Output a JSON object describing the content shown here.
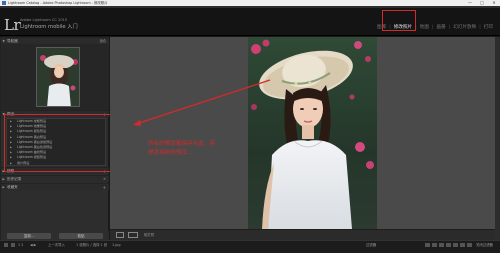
{
  "window": {
    "title": "Lightroom Catalog - Adobe Photoshop Lightroom - 修改照片",
    "controls": [
      "—",
      "□",
      "✕"
    ]
  },
  "identity": {
    "logo": "Lr",
    "line1": "Adobe Lightroom CC 2015",
    "line2": "Lightroom mobile 入门",
    "modules": [
      "图库",
      "修改照片",
      "地图",
      "画册",
      "幻灯片放映",
      "打印"
    ],
    "active_module": "修改照片"
  },
  "left_panel": {
    "navigator_label": "导航器",
    "navigator_right": "适合",
    "presets_label": "预设",
    "presets": [
      "Lightroom 常规预设",
      "Lightroom 效果预设",
      "Lightroom 颜色预设",
      "Lightroom 黑白预设",
      "Lightroom 黑白滤镜预设",
      "Lightroom 黑白色调预设",
      "Lightroom 曲线预设",
      "Lightroom 视频预设",
      "用户预设"
    ],
    "snapshots_label": "快照",
    "history_label": "历史记录",
    "collections_label": "收藏夹",
    "copy_button": "复制...",
    "paste_button": "粘贴"
  },
  "annotation": {
    "line1": "所有的预设都保存在此，若",
    "line2": "想添加新的预设…"
  },
  "toolbar": {
    "softproof": "软打样"
  },
  "filmstrip": {
    "pages": "1 2",
    "nav": "◀ ▶",
    "source": "上一次导入",
    "info": "1 张照片 / 选择 1 张",
    "filename": "1.jpg",
    "filter": "过滤器",
    "filter_value": "关闭过滤器"
  },
  "colors": {
    "accent": "#d42a2a",
    "bg": "#1a1a1a",
    "panel": "#2d2d2d",
    "canvas": "#4a4a4a"
  }
}
